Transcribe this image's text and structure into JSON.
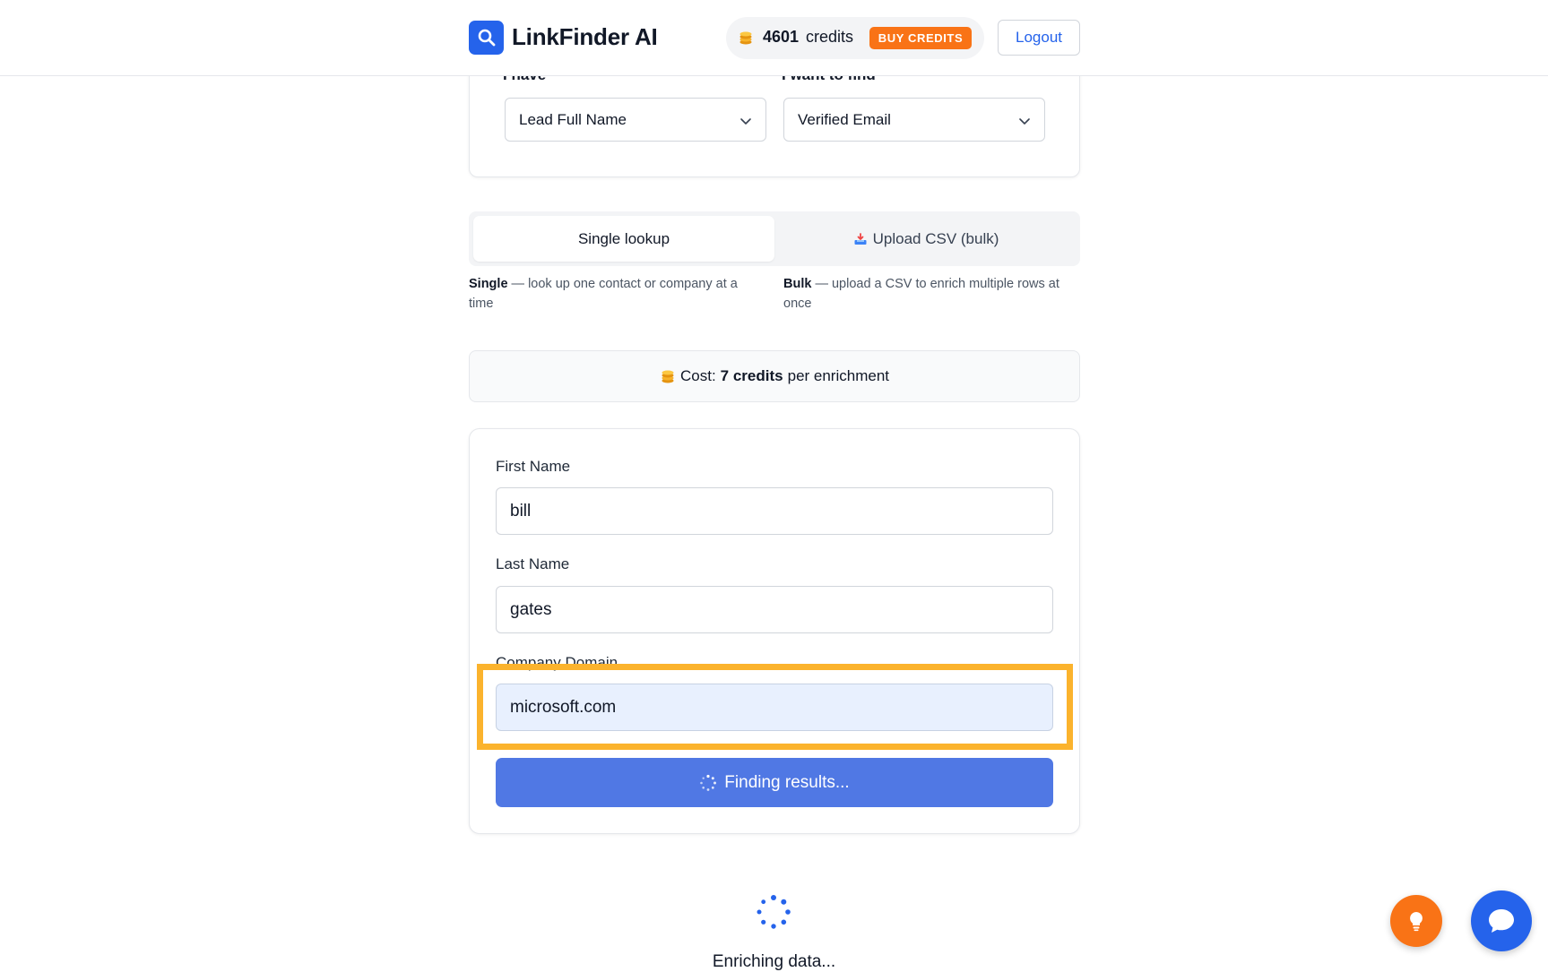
{
  "header": {
    "brand": "LinkFinder AI",
    "credits_count": "4601",
    "credits_label": "credits",
    "buy_label": "BUY CREDITS",
    "logout_label": "Logout"
  },
  "config": {
    "have_label": "I have",
    "want_label": "I want to find",
    "have_value": "Lead Full Name",
    "want_value": "Verified Email"
  },
  "mode_tabs": {
    "single_label": "Single lookup",
    "bulk_label": "Upload CSV (bulk)",
    "single_desc_bold": "Single",
    "single_desc": " — look up one contact or company at a time",
    "bulk_desc_bold": "Bulk",
    "bulk_desc": " — upload a CSV to enrich multiple rows at once"
  },
  "cost": {
    "prefix": "Cost:",
    "amount": "7 credits",
    "suffix": "per enrichment"
  },
  "form": {
    "first_name_label": "First Name",
    "first_name_value": "bill",
    "last_name_label": "Last Name",
    "last_name_value": "gates",
    "domain_label": "Company Domain",
    "domain_value": "microsoft.com",
    "submit_label": "Finding results..."
  },
  "status": {
    "enriching_text": "Enriching data..."
  },
  "colors": {
    "accent": "#2563eb",
    "orange": "#f97316",
    "highlight": "#fbb32d",
    "button": "#5078e4"
  },
  "icons": {
    "logo": "search-icon",
    "coins": "coins-icon",
    "upload": "inbox-tray-icon",
    "spinner": "spinner-icon",
    "bulb": "lightbulb-icon",
    "chat": "chat-icon"
  }
}
